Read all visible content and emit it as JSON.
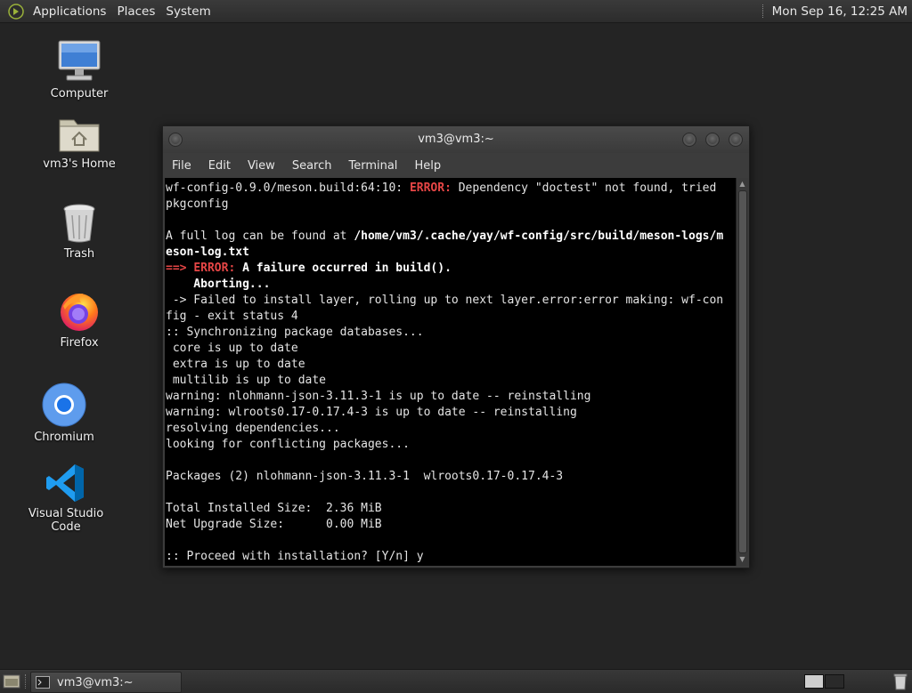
{
  "top_panel": {
    "menus": [
      "Applications",
      "Places",
      "System"
    ],
    "clock": "Mon Sep 16, 12:25 AM"
  },
  "desktop_icons": [
    {
      "label": "Computer",
      "icon": "computer-icon"
    },
    {
      "label": "vm3's Home",
      "icon": "home-folder-icon"
    },
    {
      "label": "Trash",
      "icon": "trash-icon"
    },
    {
      "label": "Firefox",
      "icon": "firefox-icon"
    },
    {
      "label": "Chromium",
      "icon": "chromium-icon"
    },
    {
      "label": "Visual Studio Code",
      "icon": "vscode-icon"
    }
  ],
  "window": {
    "title": "vm3@vm3:~",
    "menu": [
      "File",
      "Edit",
      "View",
      "Search",
      "Terminal",
      "Help"
    ]
  },
  "terminal": {
    "lines": [
      [
        {
          "t": "wf-config-0.9.0/meson.build:64:10: "
        },
        {
          "t": "ERROR:",
          "c": "red"
        },
        {
          "t": " Dependency \"doctest\" not found, tried"
        }
      ],
      [
        {
          "t": "pkgconfig"
        }
      ],
      [
        {
          "t": ""
        }
      ],
      [
        {
          "t": "A full log can be found at "
        },
        {
          "t": "/home/vm3/.cache/yay/wf-config/src/build/meson-logs/m",
          "c": "bold"
        }
      ],
      [
        {
          "t": "eson-log.txt",
          "c": "bold"
        }
      ],
      [
        {
          "t": "==> ",
          "c": "red"
        },
        {
          "t": "ERROR:",
          "c": "red"
        },
        {
          "t": " A failure occurred in build().",
          "c": "bold"
        }
      ],
      [
        {
          "t": "    Aborting...",
          "c": "bold"
        }
      ],
      [
        {
          "t": " -> Failed to install layer, rolling up to next layer.error:error making: wf-con"
        }
      ],
      [
        {
          "t": "fig - exit status 4"
        }
      ],
      [
        {
          "t": ":: Synchronizing package databases..."
        }
      ],
      [
        {
          "t": " core is up to date"
        }
      ],
      [
        {
          "t": " extra is up to date"
        }
      ],
      [
        {
          "t": " multilib is up to date"
        }
      ],
      [
        {
          "t": "warning: nlohmann-json-3.11.3-1 is up to date -- reinstalling"
        }
      ],
      [
        {
          "t": "warning: wlroots0.17-0.17.4-3 is up to date -- reinstalling"
        }
      ],
      [
        {
          "t": "resolving dependencies..."
        }
      ],
      [
        {
          "t": "looking for conflicting packages..."
        }
      ],
      [
        {
          "t": ""
        }
      ],
      [
        {
          "t": "Packages (2) nlohmann-json-3.11.3-1  wlroots0.17-0.17.4-3"
        }
      ],
      [
        {
          "t": ""
        }
      ],
      [
        {
          "t": "Total Installed Size:  2.36 MiB"
        }
      ],
      [
        {
          "t": "Net Upgrade Size:      0.00 MiB"
        }
      ],
      [
        {
          "t": ""
        }
      ],
      [
        {
          "t": ":: Proceed with installation? [Y/n] y"
        }
      ]
    ]
  },
  "taskbar": {
    "task_label": "vm3@vm3:~"
  },
  "colors": {
    "error_red": "#e64646",
    "terminal_bg": "#000000",
    "desktop_bg": "#242424"
  }
}
